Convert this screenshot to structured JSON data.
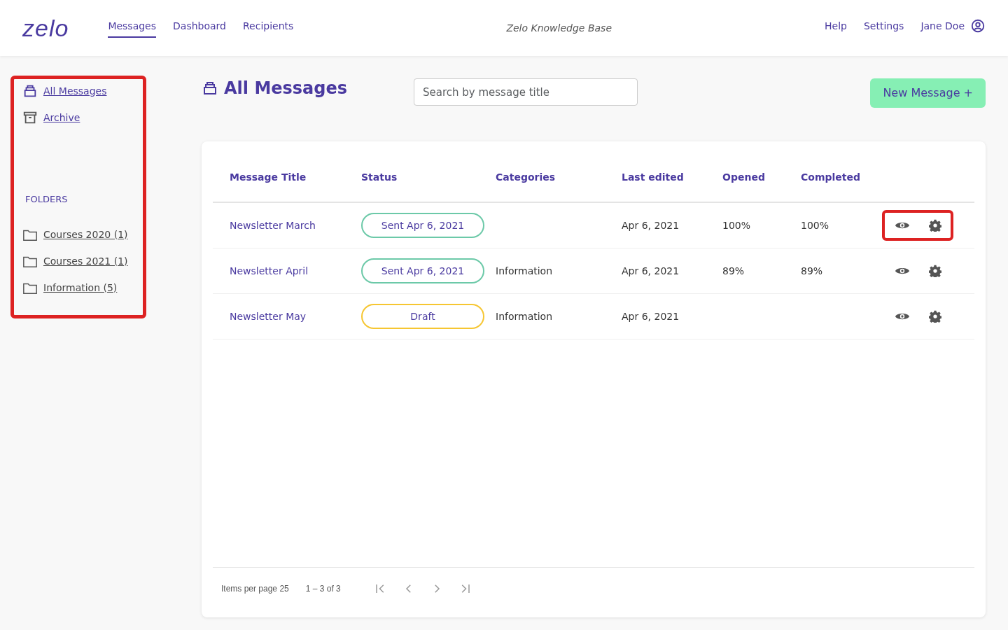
{
  "logo": "zelo",
  "nav": [
    {
      "label": "Messages",
      "selected": true
    },
    {
      "label": "Dashboard",
      "selected": false
    },
    {
      "label": "Recipients",
      "selected": false
    }
  ],
  "center_title": "Zelo Knowledge Base",
  "nav_right": {
    "help": "Help",
    "settings": "Settings",
    "user": "Jane Doe"
  },
  "sidebar": {
    "highlighted": true,
    "items": [
      {
        "label": "All Messages",
        "kind": "inbox"
      },
      {
        "label": "Archive",
        "kind": "archive"
      }
    ],
    "folders_heading": "FOLDERS",
    "folders": [
      {
        "label": "Courses 2020 (1)"
      },
      {
        "label": "Courses 2021 (1)"
      },
      {
        "label": "Information (5)"
      }
    ]
  },
  "page_title": "All Messages",
  "search": {
    "placeholder": "Search by message title"
  },
  "new_button": "New Message +",
  "table": {
    "columns": [
      "Message Title",
      "Status",
      "Categories",
      "Last edited",
      "Opened",
      "Completed"
    ],
    "rows": [
      {
        "title": "Newsletter March",
        "status": {
          "text": "Sent Apr 6, 2021",
          "kind": "sent"
        },
        "category": "",
        "last_edited": "Apr 6, 2021",
        "opened": "100%",
        "completed": "100%",
        "actions_highlighted": true
      },
      {
        "title": "Newsletter April",
        "status": {
          "text": "Sent Apr 6, 2021",
          "kind": "sent"
        },
        "category": "Information",
        "last_edited": "Apr 6, 2021",
        "opened": "89%",
        "completed": "89%",
        "actions_highlighted": false
      },
      {
        "title": "Newsletter May",
        "status": {
          "text": "Draft",
          "kind": "draft"
        },
        "category": "Information",
        "last_edited": "Apr 6, 2021",
        "opened": "",
        "completed": "",
        "actions_highlighted": false
      }
    ]
  },
  "pagination": {
    "items_per_page": "Items per page 25",
    "range": "1 – 3 of 3"
  }
}
